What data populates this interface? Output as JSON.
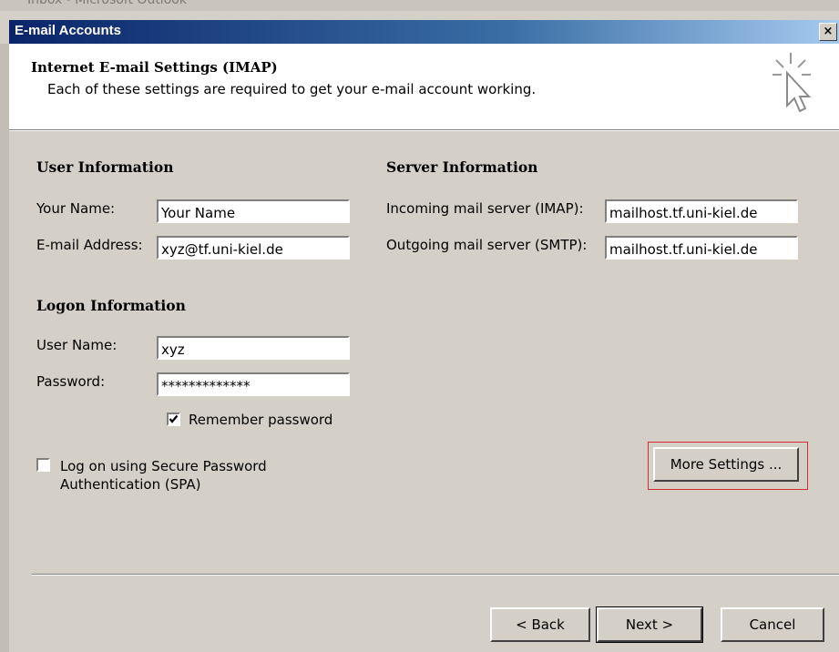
{
  "background_window_title": "Inbox - Microsoft Outlook",
  "window": {
    "title": "E-mail Accounts",
    "close_glyph": "×"
  },
  "header": {
    "title": "Internet E-mail Settings (IMAP)",
    "subtitle": "Each of these settings are required to get your e-mail account working.",
    "icon": "wizard-cursor-icon"
  },
  "user_info": {
    "heading": "User Information",
    "name_label": "Your Name:",
    "name_value": "Your Name",
    "email_label": "E-mail Address:",
    "email_value": "xyz@tf.uni-kiel.de"
  },
  "server_info": {
    "heading": "Server Information",
    "incoming_label": "Incoming mail server (IMAP):",
    "incoming_value": "mailhost.tf.uni-kiel.de",
    "outgoing_label": "Outgoing mail server (SMTP):",
    "outgoing_value": "mailhost.tf.uni-kiel.de"
  },
  "logon_info": {
    "heading": "Logon Information",
    "username_label": "User Name:",
    "username_value": "xyz",
    "password_label": "Password:",
    "password_value": "*************",
    "remember_label": "Remember password",
    "remember_checked": true
  },
  "spa": {
    "label_line1": "Log on using Secure Password",
    "label_line2": "Authentication (SPA)",
    "checked": false
  },
  "buttons": {
    "more_settings": "More Settings ...",
    "back": "< Back",
    "next": "Next >",
    "cancel": "Cancel"
  },
  "colors": {
    "dialog_bg": "#d4d0c8",
    "titlebar_start": "#0a246a",
    "titlebar_end": "#a6caf0",
    "highlight_border": "#d03030"
  }
}
